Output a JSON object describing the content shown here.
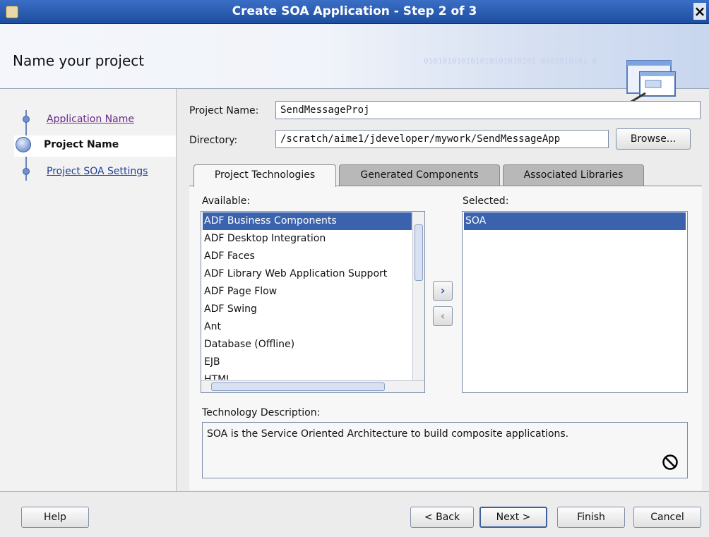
{
  "window": {
    "title": "Create SOA Application - Step 2 of 3",
    "close_symbol": "×"
  },
  "banner": {
    "heading": "Name your project",
    "binary_text": "010101010101010101010101  0101010101 0"
  },
  "nav": {
    "items": [
      {
        "label": "Application Name",
        "state": "visited"
      },
      {
        "label": "Project Name",
        "state": "current"
      },
      {
        "label": "Project SOA Settings",
        "state": "link"
      }
    ]
  },
  "form": {
    "project_name_label": "Project Name:",
    "project_name_value": "SendMessageProj",
    "directory_label": "Directory:",
    "directory_value": "/scratch/aime1/jdeveloper/mywork/SendMessageApp",
    "browse_label": "Browse..."
  },
  "tabs": [
    {
      "label": "Project Technologies",
      "active": true
    },
    {
      "label": "Generated Components",
      "active": false
    },
    {
      "label": "Associated Libraries",
      "active": false
    }
  ],
  "available": {
    "label": "Available:",
    "items": [
      "ADF Business Components",
      "ADF Desktop Integration",
      "ADF Faces",
      "ADF Library Web Application Support",
      "ADF Page Flow",
      "ADF Swing",
      "Ant",
      "Database (Offline)",
      "EJB",
      "HTML"
    ],
    "selected_index": 0
  },
  "selected": {
    "label": "Selected:",
    "items": [
      "SOA"
    ]
  },
  "move_right_symbol": "›",
  "move_left_symbol": "‹",
  "description": {
    "label": "Technology Description:",
    "text": "SOA is the Service Oriented Architecture to build composite applications."
  },
  "buttons": {
    "help": "Help",
    "back": "< Back",
    "next": "Next >",
    "finish": "Finish",
    "cancel": "Cancel"
  },
  "colors": {
    "title_bar": "#1d4e9f",
    "selection": "#3b62ad",
    "nav_link": "#1f3d99"
  }
}
